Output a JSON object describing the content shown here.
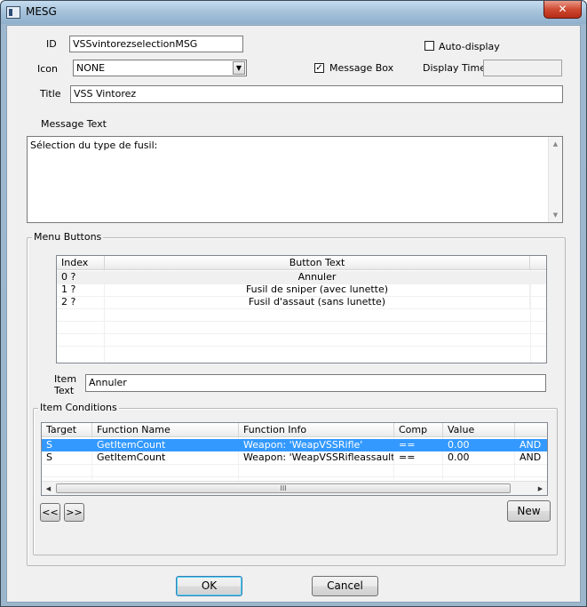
{
  "window": {
    "title": "MESG",
    "close_glyph": "✕"
  },
  "form": {
    "id_label": "ID",
    "id_value": "VSSvintorezselectionMSG",
    "auto_display_label": "Auto-display",
    "auto_display_checked": false,
    "icon_label": "Icon",
    "icon_value": "NONE",
    "message_box_label": "Message Box",
    "message_box_checked": true,
    "display_time_label": "Display Time",
    "display_time_value": "",
    "title_label": "Title",
    "title_value": "VSS Vintorez",
    "message_text_label": "Message Text",
    "message_text_value": "Sélection du type de fusil:"
  },
  "menu_buttons": {
    "group_title": "Menu Buttons",
    "columns": [
      "Index",
      "Button Text"
    ],
    "rows": [
      {
        "index": "0 ?",
        "text": "Annuler"
      },
      {
        "index": "1 ?",
        "text": "Fusil de sniper (avec lunette)"
      },
      {
        "index": "2 ?",
        "text": "Fusil d'assaut (sans lunette)"
      }
    ],
    "item_text_label_line1": "Item",
    "item_text_label_line2": "Text",
    "item_text_value": "Annuler"
  },
  "item_conditions": {
    "group_title": "Item Conditions",
    "columns": [
      "Target",
      "Function Name",
      "Function Info",
      "Comp",
      "Value",
      ""
    ],
    "rows": [
      {
        "target": "S",
        "function_name": "GetItemCount",
        "function_info": "Weapon: 'WeapVSSRifle'",
        "comp": "==",
        "value": "0.00",
        "op": "AND",
        "selected": true
      },
      {
        "target": "S",
        "function_name": "GetItemCount",
        "function_info": "Weapon: 'WeapVSSRifleassault'",
        "comp": "==",
        "value": "0.00",
        "op": "AND",
        "selected": false
      }
    ],
    "prev_label": "<<",
    "next_label": ">>",
    "new_label": "New",
    "scroll_thumb_glyph": "III"
  },
  "footer": {
    "ok_label": "OK",
    "cancel_label": "Cancel"
  },
  "colors": {
    "selection": "#3399ff",
    "close_button": "#c8452d",
    "title_bar": "#a7c3db"
  },
  "icons": [
    "app-icon",
    "close-icon",
    "dropdown-arrow-icon",
    "scroll-up-icon",
    "scroll-down-icon",
    "scroll-left-icon",
    "scroll-right-icon"
  ]
}
